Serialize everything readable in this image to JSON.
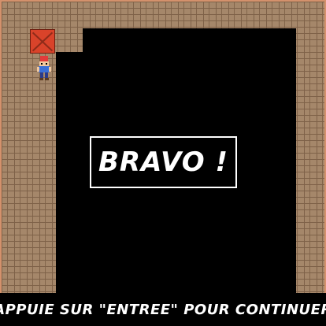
{
  "banner": {
    "text": "BRAVO !"
  },
  "footer": {
    "text": "APPUIE SUR \"ENTREE\" POUR CONTINUER"
  },
  "colors": {
    "wall": "#a5876a",
    "mortar": "#7e6148",
    "border": "#d4916c",
    "crate": "#d9432a",
    "floor": "#000000"
  },
  "sprites": {
    "crate": "crate-icon",
    "player": "player-icon"
  }
}
